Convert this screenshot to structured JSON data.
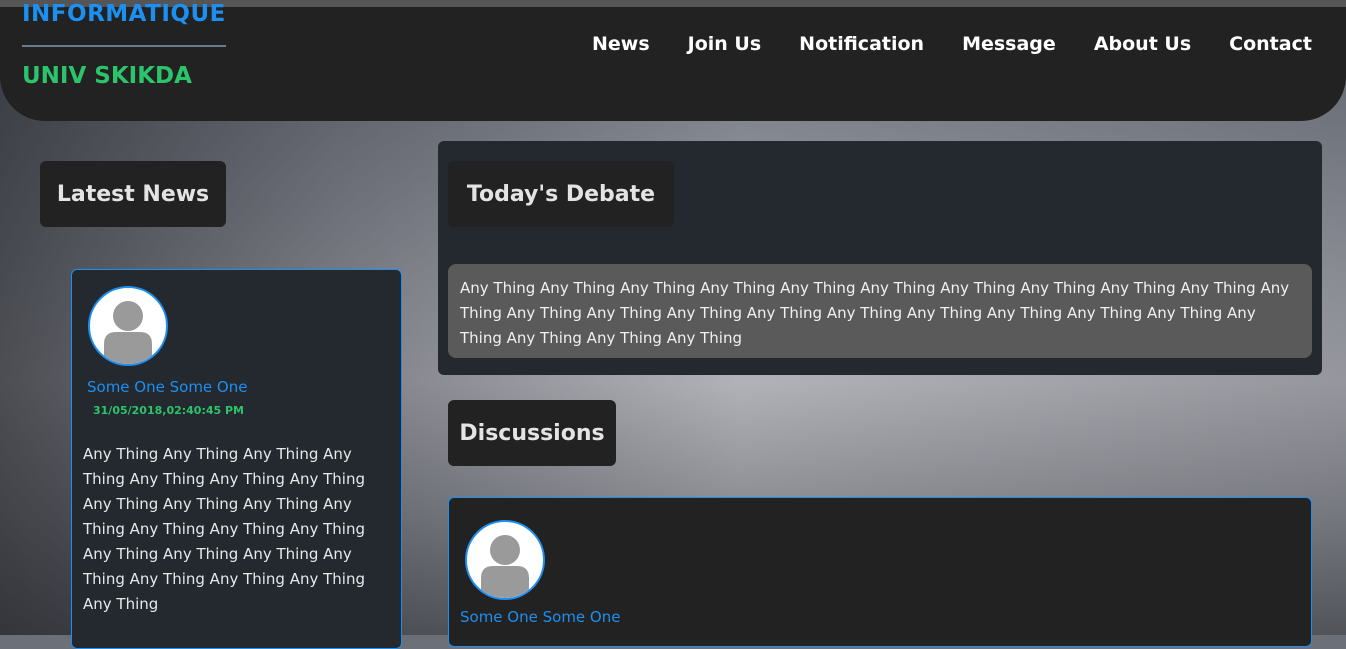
{
  "brand": {
    "top": "INFORMATIQUE",
    "bottom": "UNIV SKIKDA"
  },
  "nav": {
    "items": [
      {
        "label": "News"
      },
      {
        "label": "Join Us"
      },
      {
        "label": "Notification"
      },
      {
        "label": "Message"
      },
      {
        "label": "About Us"
      },
      {
        "label": "Contact"
      }
    ]
  },
  "latest_news": {
    "title": "Latest News",
    "card": {
      "author": "Some One Some One",
      "date": "31/05/2018,02:40:45 PM",
      "body": "Any Thing Any Thing Any Thing Any Thing Any Thing Any Thing Any Thing Any Thing Any Thing Any Thing Any Thing Any Thing Any Thing Any Thing Any Thing Any Thing Any Thing Any Thing Any Thing Any Thing Any Thing Any Thing"
    }
  },
  "debate": {
    "title": "Today's Debate",
    "text": "Any Thing Any Thing Any Thing Any Thing Any Thing Any Thing Any Thing Any Thing Any Thing Any Thing Any Thing Any Thing Any Thing Any Thing Any Thing Any Thing Any Thing Any Thing Any Thing Any Thing Any Thing Any Thing Any Thing Any Thing"
  },
  "discussions": {
    "title": "Discussions",
    "card": {
      "author": "Some One Some One"
    }
  },
  "colors": {
    "brand_blue": "#1d8ff0",
    "brand_green": "#2bc46a",
    "header_bg": "#222222",
    "panel_bg": "#23292e"
  },
  "icons": {
    "avatar": "user-avatar-icon"
  }
}
